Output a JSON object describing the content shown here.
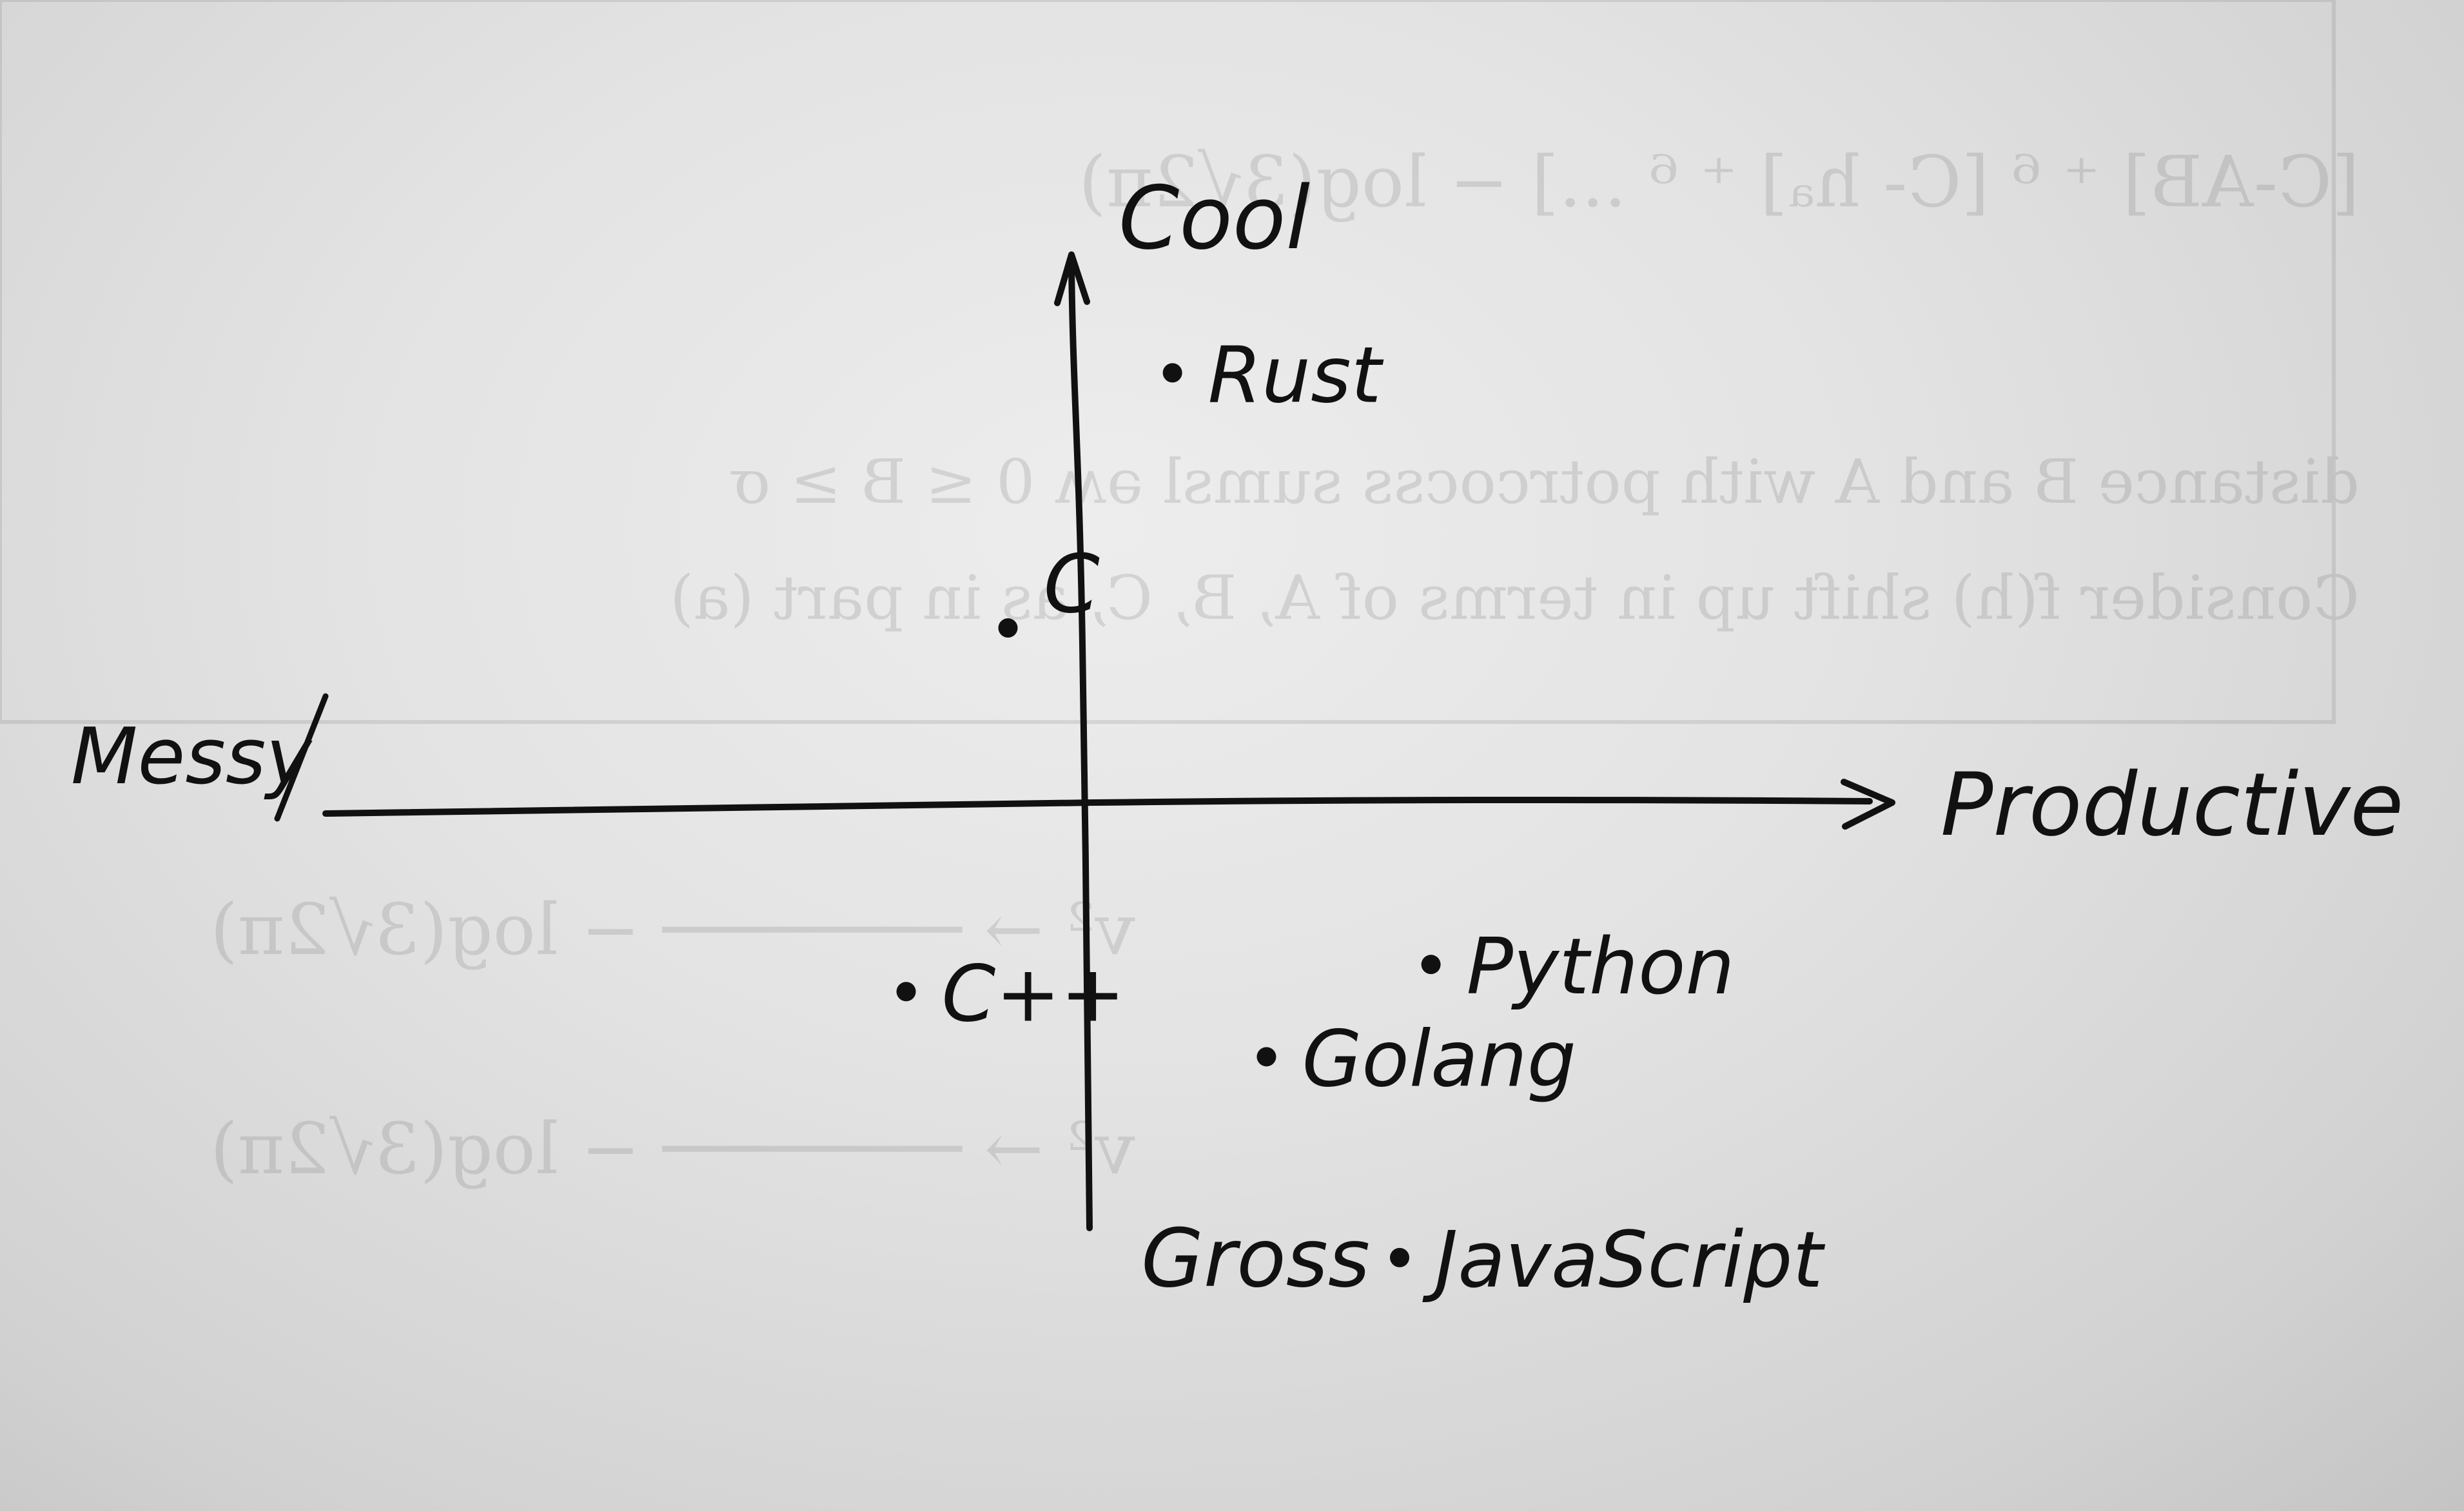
{
  "chart_data": {
    "type": "scatter",
    "title": "",
    "x_axis": {
      "negative_label": "Messy",
      "positive_label": "Productive",
      "range": [
        -10,
        10
      ]
    },
    "y_axis": {
      "positive_label": "Cool",
      "negative_label": "Gross",
      "range": [
        -10,
        10
      ]
    },
    "grid": false,
    "points": [
      {
        "label": "Rust",
        "x": 1.1,
        "y": 8.0
      },
      {
        "label": "C",
        "x": -1.0,
        "y": 3.3
      },
      {
        "label": "C++",
        "x": -2.3,
        "y": -3.4
      },
      {
        "label": "Python",
        "x": 4.4,
        "y": -2.9
      },
      {
        "label": "Golang",
        "x": 2.3,
        "y": -4.6
      },
      {
        "label": "JavaScript",
        "x": 4.0,
        "y": -8.3
      }
    ],
    "colors": {
      "ink": "#111111",
      "paper": "#e6e6e6"
    }
  }
}
